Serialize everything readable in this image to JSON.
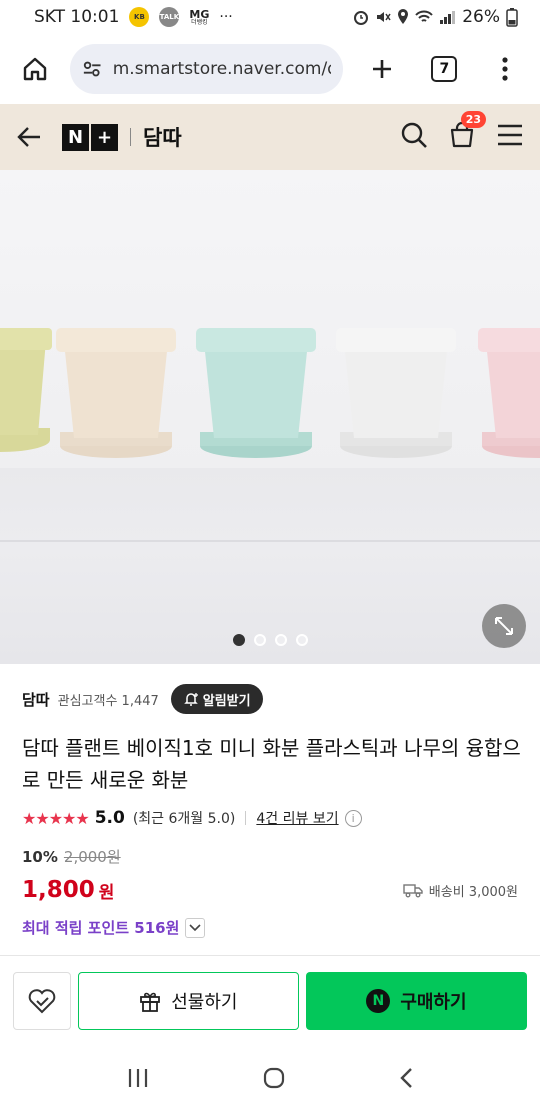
{
  "status_bar": {
    "carrier_time": "SKT 10:01",
    "mini_icons": [
      "KB",
      "TALK"
    ],
    "mg_label": "MG",
    "mg_sub": "더뱅킹",
    "more": "···",
    "battery": "26%"
  },
  "browser": {
    "url": "m.smartstore.naver.com/da",
    "tab_count": "7"
  },
  "store_header": {
    "logo_n": "N",
    "logo_plus": "+",
    "store_name": "담따",
    "cart_count": "23"
  },
  "hero": {
    "current_slide": 1,
    "total_slides": 4
  },
  "product": {
    "store_name": "담따",
    "followers_label": "관심고객수 1,447",
    "alarm_label": "알림받기",
    "title": "담따 플랜트 베이직1호 미니 화분 플라스틱과 나무의 융합으로 만든 새로운 화분",
    "stars": "★★★★★",
    "score": "5.0",
    "recent_score": "(최근 6개월 5.0)",
    "review_link": "4건 리뷰 보기",
    "discount": "10%",
    "original_price": "2,000원",
    "price": "1,800",
    "currency": "원",
    "shipping": "배송비 3,000원",
    "points": "최대 적립 포인트 516원"
  },
  "bottom_bar": {
    "gift_label": "선물하기",
    "buy_label": "구매하기",
    "n_mark": "N"
  },
  "colors": {
    "naver_green": "#03c75a",
    "price_red": "#d0021b",
    "points_purple": "#7a40c8",
    "header_bg": "#efe7dc"
  }
}
